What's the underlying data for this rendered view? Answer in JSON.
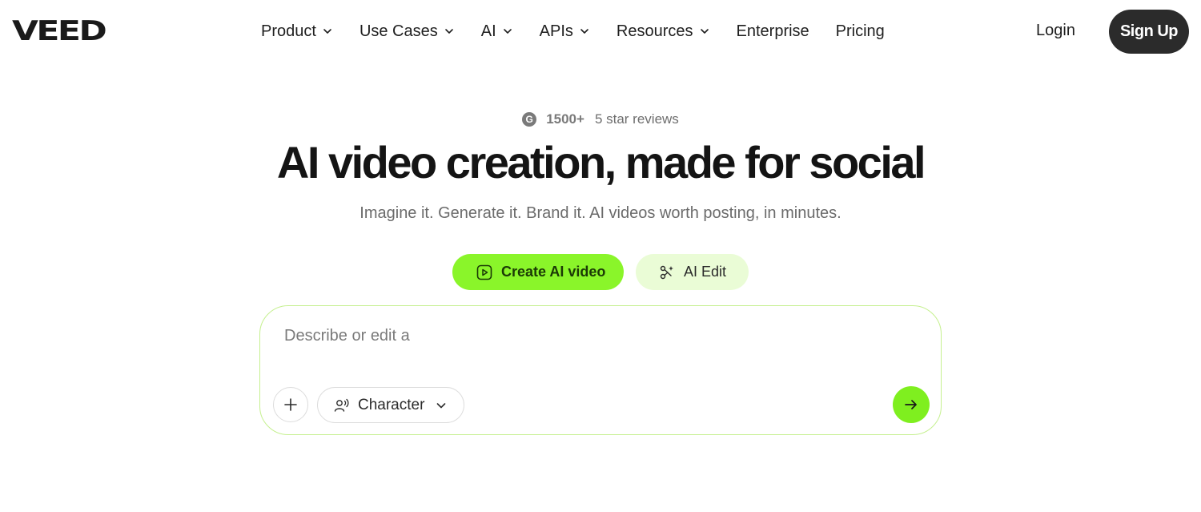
{
  "header": {
    "logo": "VEED",
    "nav": [
      {
        "label": "Product",
        "has_dropdown": true
      },
      {
        "label": "Use Cases",
        "has_dropdown": true
      },
      {
        "label": "AI",
        "has_dropdown": true
      },
      {
        "label": "APIs",
        "has_dropdown": true
      },
      {
        "label": "Resources",
        "has_dropdown": true
      },
      {
        "label": "Enterprise",
        "has_dropdown": false
      },
      {
        "label": "Pricing",
        "has_dropdown": false
      }
    ],
    "login_label": "Login",
    "signup_label": "Sign Up"
  },
  "hero": {
    "reviews_icon": "g2-icon",
    "reviews_count": "1500+",
    "reviews_text": "5 star reviews",
    "headline": "AI video creation, made for social",
    "subheadline": "Imagine it. Generate it. Brand it. AI videos worth posting, in minutes.",
    "modes": [
      {
        "label": "Create AI video",
        "icon": "play-square-icon",
        "active": true
      },
      {
        "label": "AI Edit",
        "icon": "magic-scissors-icon",
        "active": false
      }
    ]
  },
  "prompt": {
    "placeholder": "Describe or edit a",
    "value": "",
    "character_label": "Character",
    "add_icon": "plus-icon",
    "send_icon": "arrow-right-icon"
  },
  "colors": {
    "accent": "#8af52a",
    "accent_light": "#eafcd6",
    "dark_button": "#2b2b2b",
    "prompt_border": "#c5f08f"
  }
}
